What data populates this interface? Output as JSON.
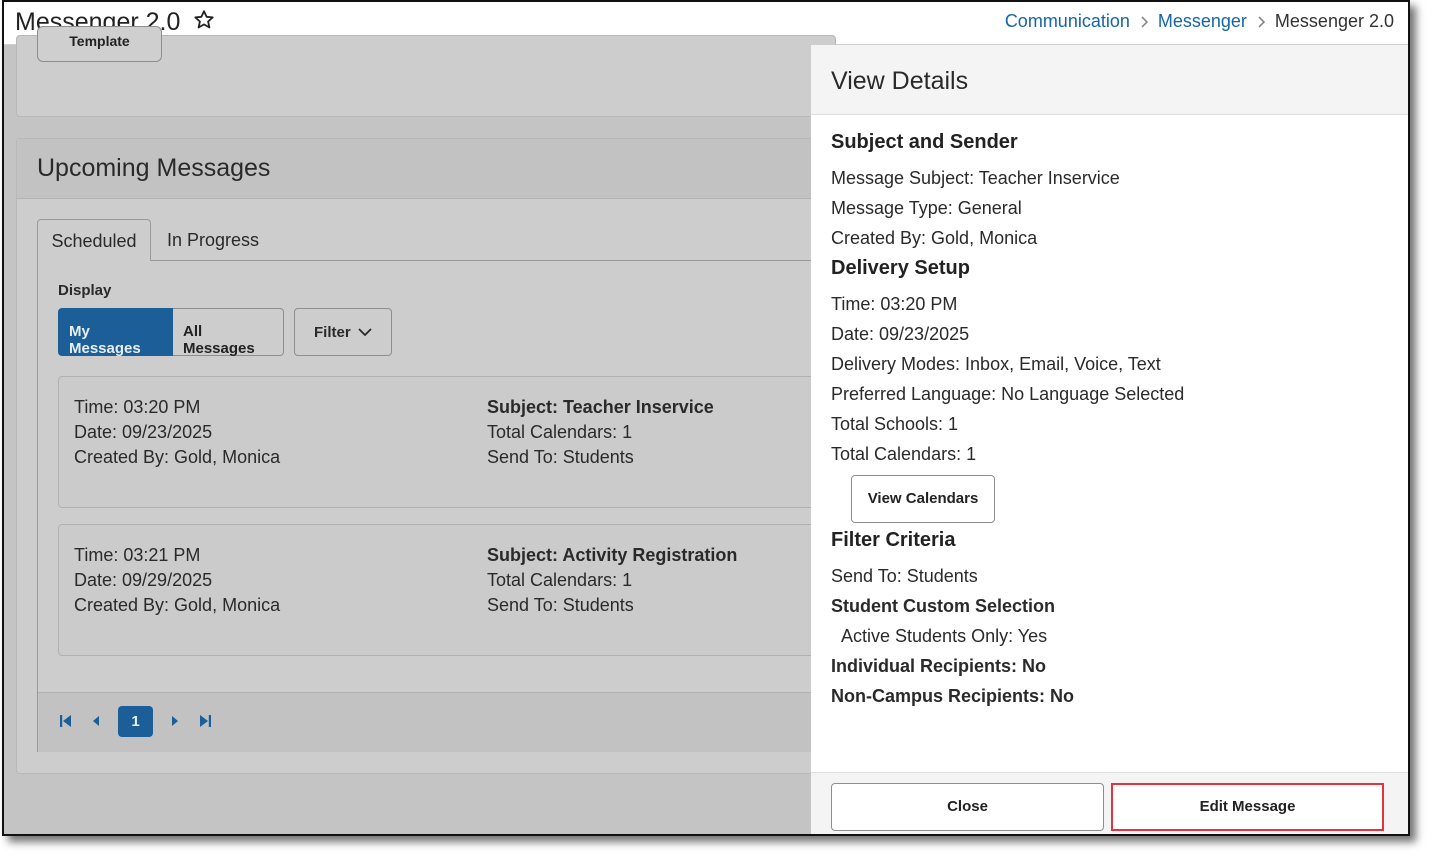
{
  "header": {
    "title": "Messenger 2.0",
    "breadcrumb": [
      {
        "label": "Communication"
      },
      {
        "label": "Messenger"
      },
      {
        "label": "Messenger 2.0"
      }
    ]
  },
  "top_card": {
    "template_button": "Template"
  },
  "upcoming": {
    "title": "Upcoming Messages",
    "tabs": [
      {
        "label": "Scheduled",
        "active": true
      },
      {
        "label": "In Progress",
        "active": false
      }
    ],
    "display_label": "Display",
    "display_options": [
      {
        "label": "My Messages",
        "selected": true
      },
      {
        "label": "All Messages",
        "selected": false
      }
    ],
    "filter_label": "Filter",
    "messages": [
      {
        "time": "Time: 03:20 PM",
        "date": "Date: 09/23/2025",
        "created_by": "Created By: Gold, Monica",
        "subject": "Subject: Teacher Inservice",
        "total_calendars": "Total Calendars: 1",
        "send_to": "Send To: Students"
      },
      {
        "time": "Time: 03:21 PM",
        "date": "Date: 09/29/2025",
        "created_by": "Created By: Gold, Monica",
        "subject": "Subject: Activity Registration",
        "total_calendars": "Total Calendars: 1",
        "send_to": "Send To: Students"
      }
    ],
    "pager": {
      "current_page": "1"
    }
  },
  "drawer": {
    "title": "View Details",
    "subject_section": {
      "title": "Subject and Sender",
      "lines": [
        "Message Subject: Teacher Inservice",
        "Message Type: General",
        "Created By: Gold, Monica"
      ]
    },
    "delivery_section": {
      "title": "Delivery Setup",
      "lines": [
        "Time: 03:20 PM",
        "Date: 09/23/2025",
        "Delivery Modes: Inbox, Email, Voice, Text",
        "Preferred Language: No Language Selected",
        "Total Schools: 1",
        "Total Calendars: 1"
      ],
      "view_calendars_button": "View Calendars"
    },
    "filter_section": {
      "title": "Filter Criteria",
      "send_to": "Send To: Students",
      "custom_selection_title": "Student Custom Selection",
      "active_only": "Active Students Only: Yes",
      "individual_recipients": "Individual Recipients: No",
      "non_campus_recipients": "Non-Campus Recipients: No"
    },
    "footer": {
      "close_label": "Close",
      "edit_label": "Edit Message"
    }
  },
  "colors": {
    "primary": "#1b5e98",
    "link": "#1565a8",
    "highlight_border": "#e3343c",
    "overlay_gray": "#c4c4c4"
  },
  "icons": {
    "favorite": "star-outline-icon",
    "breadcrumb_separator": "chevron-right-icon",
    "filter_dropdown": "chevron-down-icon",
    "pager": [
      "first-page-icon",
      "previous-page-icon",
      "next-page-icon",
      "last-page-icon"
    ]
  }
}
